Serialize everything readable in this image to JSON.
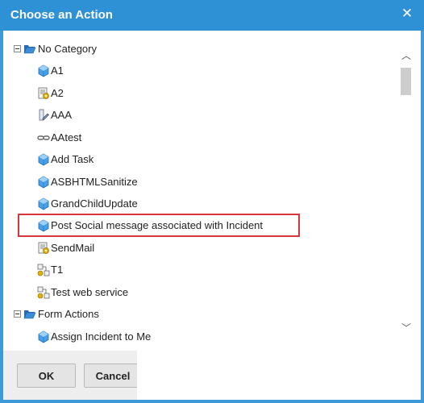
{
  "dialog": {
    "title": "Choose an Action",
    "close_glyph": "✕"
  },
  "tree": {
    "groups": [
      {
        "label": "No Category",
        "expanded": true,
        "icon": "open-folder-icon",
        "items": [
          {
            "label": "A1",
            "icon": "cube-icon"
          },
          {
            "label": "A2",
            "icon": "script-gear-icon"
          },
          {
            "label": "AAA",
            "icon": "pen-document-icon"
          },
          {
            "label": "AAtest",
            "icon": "chain-link-icon"
          },
          {
            "label": "Add Task",
            "icon": "cube-icon"
          },
          {
            "label": "ASBHTMLSanitize",
            "icon": "cube-icon"
          },
          {
            "label": "GrandChildUpdate",
            "icon": "cube-icon"
          },
          {
            "label": "Post Social message associated with Incident",
            "icon": "cube-icon",
            "highlighted": true
          },
          {
            "label": "SendMail",
            "icon": "script-gear-icon"
          },
          {
            "label": "T1",
            "icon": "web-service-icon"
          },
          {
            "label": "Test web service",
            "icon": "web-service-icon"
          }
        ]
      },
      {
        "label": "Form Actions",
        "expanded": true,
        "icon": "open-folder-icon",
        "items": [
          {
            "label": "Assign Incident to Me",
            "icon": "cube-icon"
          }
        ]
      }
    ]
  },
  "footer": {
    "ok_label": "OK",
    "cancel_label": "Cancel"
  },
  "colors": {
    "title_bar": "#2e90d5",
    "highlight_border": "#d9363b"
  }
}
